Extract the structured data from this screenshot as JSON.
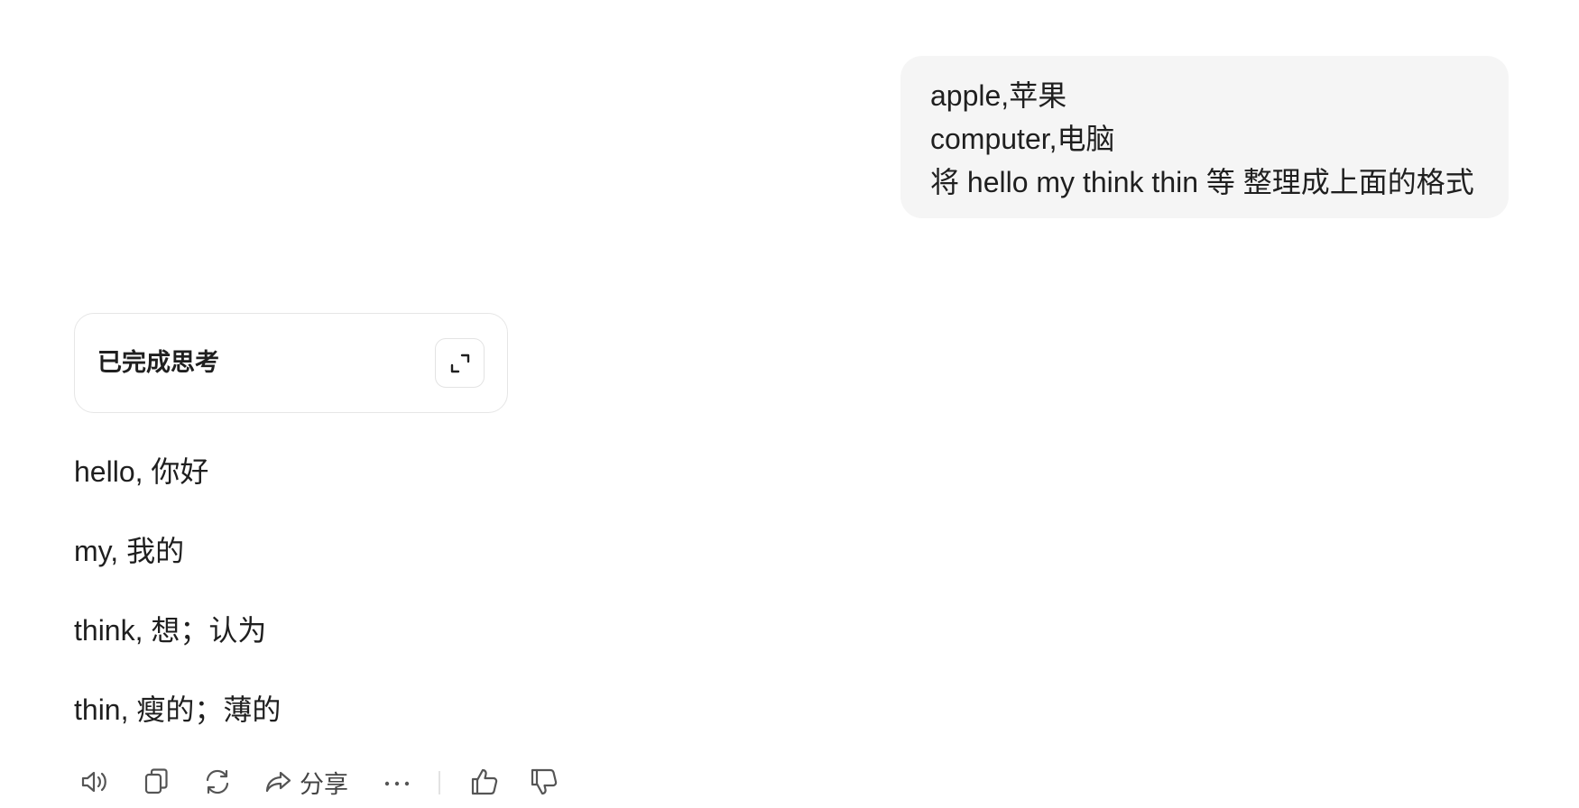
{
  "user_message": {
    "lines": [
      "apple,苹果",
      "computer,电脑",
      "将 hello my think thin 等 整理成上面的格式"
    ]
  },
  "thinking": {
    "label": "已完成思考",
    "expand_icon": "expand-icon"
  },
  "answer": {
    "lines": [
      "hello, 你好",
      "my, 我的",
      "think, 想；认为",
      "thin, 瘦的；薄的"
    ]
  },
  "actions": {
    "read_aloud_icon": "speaker-icon",
    "copy_icon": "copy-icon",
    "regenerate_icon": "refresh-icon",
    "share_icon": "share-icon",
    "share_label": "分享",
    "more_icon": "more-icon",
    "like_icon": "thumbs-up-icon",
    "dislike_icon": "thumbs-down-icon"
  }
}
